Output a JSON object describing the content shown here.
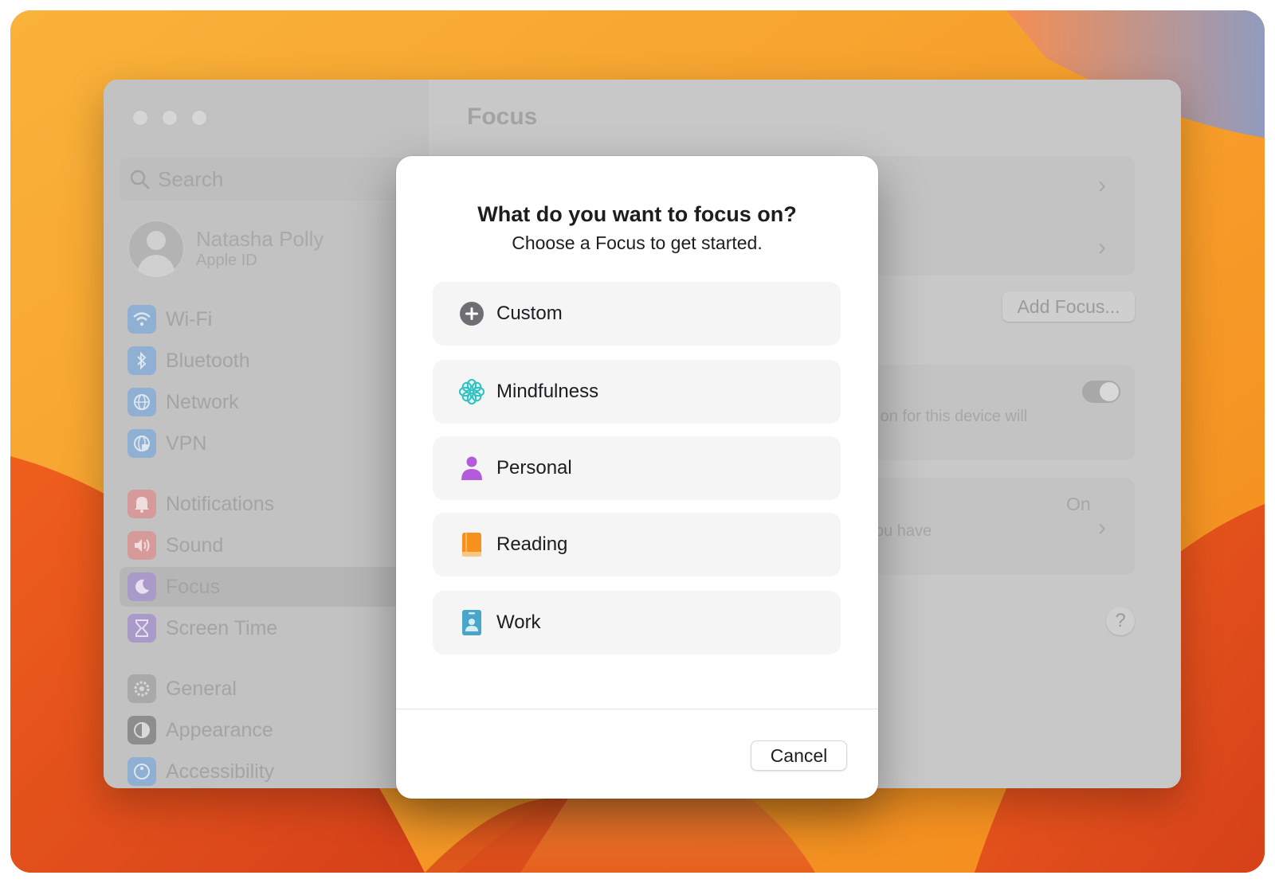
{
  "window": {
    "title": "Focus"
  },
  "sidebar": {
    "search_placeholder": "Search",
    "user": {
      "name": "Natasha Polly",
      "subtitle": "Apple ID"
    },
    "items": [
      {
        "label": "Wi-Fi",
        "icon": "wifi-icon",
        "color": "#8fb0d3"
      },
      {
        "label": "Bluetooth",
        "icon": "bluetooth-icon",
        "color": "#8fb0d3"
      },
      {
        "label": "Network",
        "icon": "globe-icon",
        "color": "#8fb0d3"
      },
      {
        "label": "VPN",
        "icon": "vpn-globe-icon",
        "color": "#8fb0d3"
      },
      {
        "label": "Notifications",
        "icon": "bell-icon",
        "color": "#d69a9a"
      },
      {
        "label": "Sound",
        "icon": "speaker-icon",
        "color": "#d69a9a"
      },
      {
        "label": "Focus",
        "icon": "moon-icon",
        "color": "#a99ac9",
        "selected": true
      },
      {
        "label": "Screen Time",
        "icon": "hourglass-icon",
        "color": "#a99ac9"
      },
      {
        "label": "General",
        "icon": "gear-icon",
        "color": "#a9a9a9"
      },
      {
        "label": "Appearance",
        "icon": "appearance-icon",
        "color": "#8d8d8d"
      },
      {
        "label": "Accessibility",
        "icon": "accessibility-icon",
        "color": "#8fb0d3"
      }
    ]
  },
  "content": {
    "add_focus_label": "Add Focus...",
    "share_text": "e on for this device will",
    "status_value": "On",
    "status_text": "you have",
    "help_label": "?"
  },
  "modal": {
    "title": "What do you want to focus on?",
    "subtitle": "Choose a Focus to get started.",
    "options": [
      {
        "label": "Custom",
        "icon": "plus-circle-icon",
        "color": "#6e6e73"
      },
      {
        "label": "Mindfulness",
        "icon": "flower-icon",
        "color": "#2fc3c3"
      },
      {
        "label": "Personal",
        "icon": "person-icon",
        "color": "#b35bdc"
      },
      {
        "label": "Reading",
        "icon": "book-icon",
        "color": "#f7911e"
      },
      {
        "label": "Work",
        "icon": "badge-icon",
        "color": "#4aa6c9"
      }
    ],
    "cancel_label": "Cancel"
  }
}
